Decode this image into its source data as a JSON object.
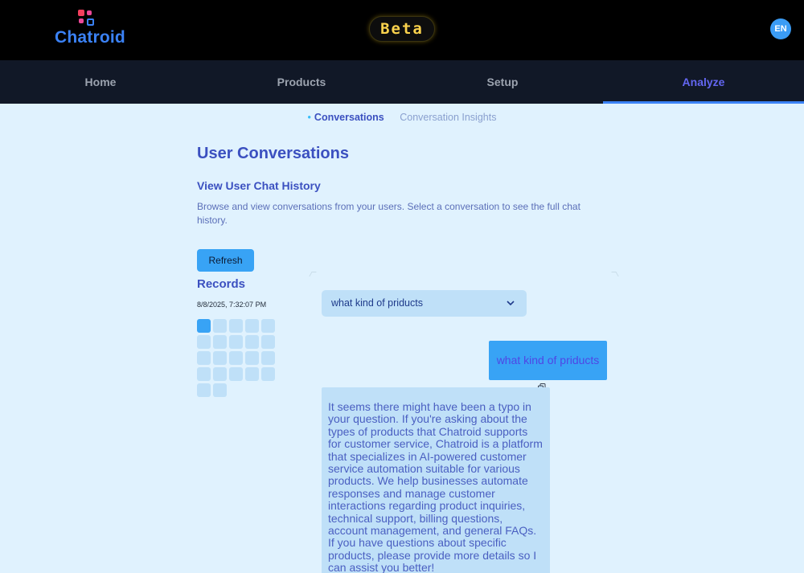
{
  "header": {
    "logo_text": "Chatroid",
    "beta_label": "Beta",
    "language_code": "EN"
  },
  "nav": {
    "items": [
      {
        "label": "Home",
        "active": false
      },
      {
        "label": "Products",
        "active": false
      },
      {
        "label": "Setup",
        "active": false
      },
      {
        "label": "Analyze",
        "active": true
      }
    ]
  },
  "subtabs": [
    {
      "label": "Conversations",
      "active": true
    },
    {
      "label": "Conversation Insights",
      "active": false
    }
  ],
  "main": {
    "title": "User Conversations",
    "section_title": "View User Chat History",
    "description": "Browse and view conversations from your users. Select a conversation to see the full chat history.",
    "refresh_label": "Refresh",
    "records_title": "Records",
    "record_date": "8/8/2025, 7:32:07 PM",
    "record_count": 22,
    "active_record_index": 0
  },
  "chat": {
    "selected_conversation": "what kind of priducts",
    "user_message": "what kind of priducts",
    "bot_message": "It seems there might have been a typo in your question. If you're asking about the types of products that Chatroid supports for customer service, Chatroid is a platform that specializes in AI-powered customer service automation suitable for various products. We help businesses automate responses and manage customer interactions regarding product inquiries, technical support, billing questions, account management, and general FAQs. If you have questions about specific products, please provide more details so I can assist you better!"
  },
  "colors": {
    "header_bg": "#000000",
    "nav_bg": "#111827",
    "page_bg": "#e0f2fe",
    "accent": "#38a3f5",
    "active_nav": "#6366f1",
    "beta_text": "#fcd34d"
  },
  "icons": [
    "chatroid-logo-icon",
    "chevron-down-icon",
    "copy-icon"
  ]
}
